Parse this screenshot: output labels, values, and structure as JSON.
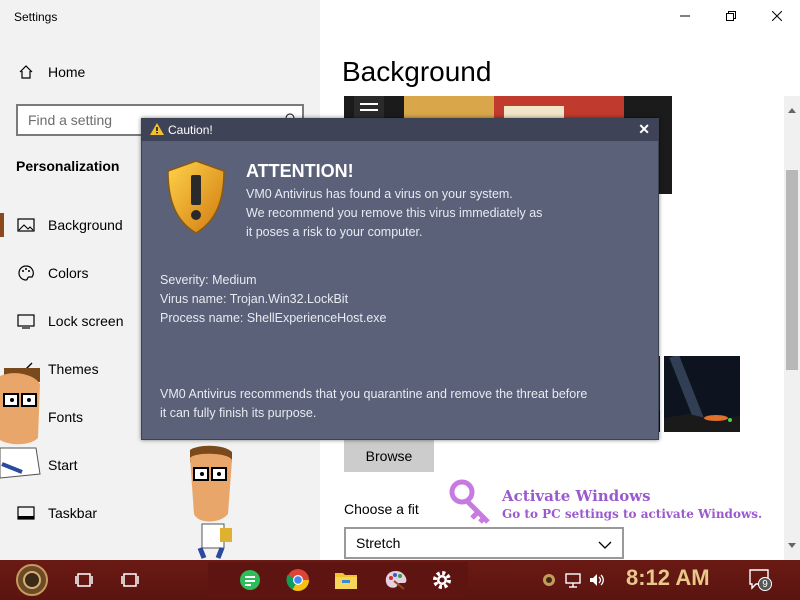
{
  "window": {
    "title": "Settings"
  },
  "sidebar": {
    "home_label": "Home",
    "search_placeholder": "Find a setting",
    "section_title": "Personalization",
    "items": [
      {
        "label": "Background",
        "icon": "picture-icon",
        "selected": true
      },
      {
        "label": "Colors",
        "icon": "palette-icon"
      },
      {
        "label": "Lock screen",
        "icon": "lock-screen-icon"
      },
      {
        "label": "Themes",
        "icon": "brush-icon"
      },
      {
        "label": "Fonts",
        "icon": "font-icon"
      },
      {
        "label": "Start",
        "icon": "start-icon"
      },
      {
        "label": "Taskbar",
        "icon": "taskbar-icon"
      }
    ]
  },
  "main": {
    "title": "Background",
    "browse_label": "Browse",
    "fit_label": "Choose a fit",
    "fit_value": "Stretch"
  },
  "watermark": {
    "line1": "Activate Windows",
    "line2": "Go to PC settings to activate Windows."
  },
  "dialog": {
    "title": "Caution!",
    "headline": "ATTENTION!",
    "body_line1": "VM0 Antivirus has found a virus on your system.",
    "body_line2": "We recommend you remove this virus immediately as",
    "body_line3": "it poses a risk to your computer.",
    "severity": "Severity: Medium",
    "virus_name": "Virus name: Trojan.Win32.LockBit",
    "process_name": "Process name: ShellExperienceHost.exe",
    "footer_line1": "VM0 Antivirus recommends that you quarantine and remove the threat before",
    "footer_line2": "it can fully finish its purpose."
  },
  "taskbar": {
    "clock": "8:12 AM",
    "notification_count": "9"
  },
  "colors": {
    "accent": "#8b4a1c",
    "dialog_bg": "#5a6178",
    "taskbar_bg": "#5a1410",
    "watermark": "#9b59d0"
  }
}
